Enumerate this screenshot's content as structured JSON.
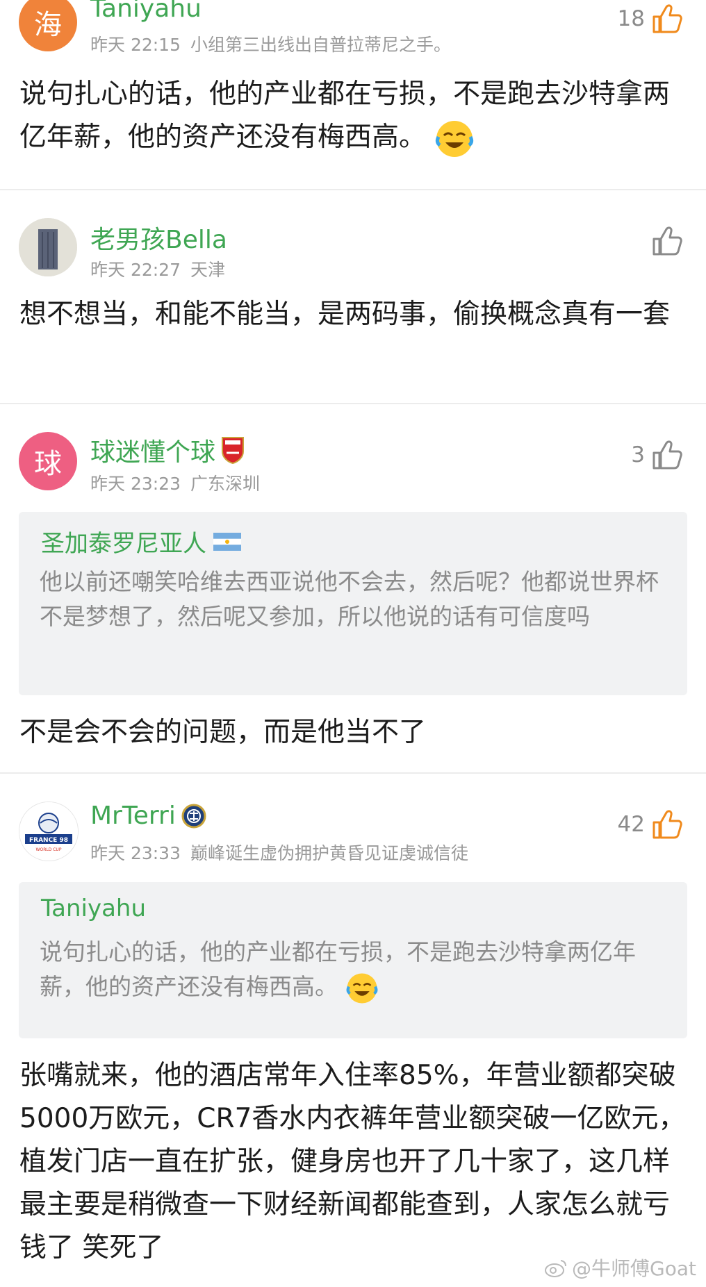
{
  "comments": [
    {
      "username": "Taniyahu",
      "avatar_char": "海",
      "avatar_color": "#f0833a",
      "time": "昨天 22:15",
      "location": "小组第三出线出自普拉蒂尼之手。",
      "likes": "18",
      "liked": true,
      "text": "说句扎心的话，他的产业都在亏损，不是跑去沙特拿两亿年薪，他的资产还没有梅西高。"
    },
    {
      "username": "老男孩Bella",
      "time": "昨天 22:27",
      "location": "天津",
      "likes": "",
      "liked": false,
      "text": "想不想当，和能不能当，是两码事，偷换概念真有一套"
    },
    {
      "username": "球迷懂个球",
      "avatar_char": "球",
      "avatar_color": "#ee5f82",
      "badge_text": "Arsenal",
      "time": "昨天 23:23",
      "location": "广东深圳",
      "likes": "3",
      "liked": false,
      "quote_name": "圣加泰罗尼亚人",
      "quote_text": "他以前还嘲笑哈维去西亚说他不会去，然后呢？他都说世界杯不是梦想了，然后呢又参加，所以他说的话有可信度吗",
      "text": "不是会不会的问题，而是他当不了"
    },
    {
      "username": "MrTerri",
      "avatar_text": "FRANCE 98",
      "avatar_subtext": "WORLD CUP",
      "time": "昨天 23:33",
      "location": "巅峰诞生虚伪拥护黄昏见证虔诚信徒",
      "likes": "42",
      "liked": true,
      "quote_name": "Taniyahu",
      "quote_text": "说句扎心的话，他的产业都在亏损，不是跑去沙特拿两亿年薪，他的资产还没有梅西高。",
      "text": "张嘴就来，他的酒店常年入住率85%，年营业额都突破5000万欧元，CR7香水内衣裤年营业额突破一亿欧元，植发门店一直在扩张，健身房也开了几十家了，这几样最主要是稍微查一下财经新闻都能查到，人家怎么就亏钱了 笑死了"
    }
  ],
  "watermark": "@牛师傅Goat",
  "colors": {
    "username": "#3fa653",
    "meta": "#9a9a9a",
    "like_active": "#f08a1c",
    "like_inactive": "#8a8a8a",
    "quote_bg": "#f1f2f3"
  }
}
